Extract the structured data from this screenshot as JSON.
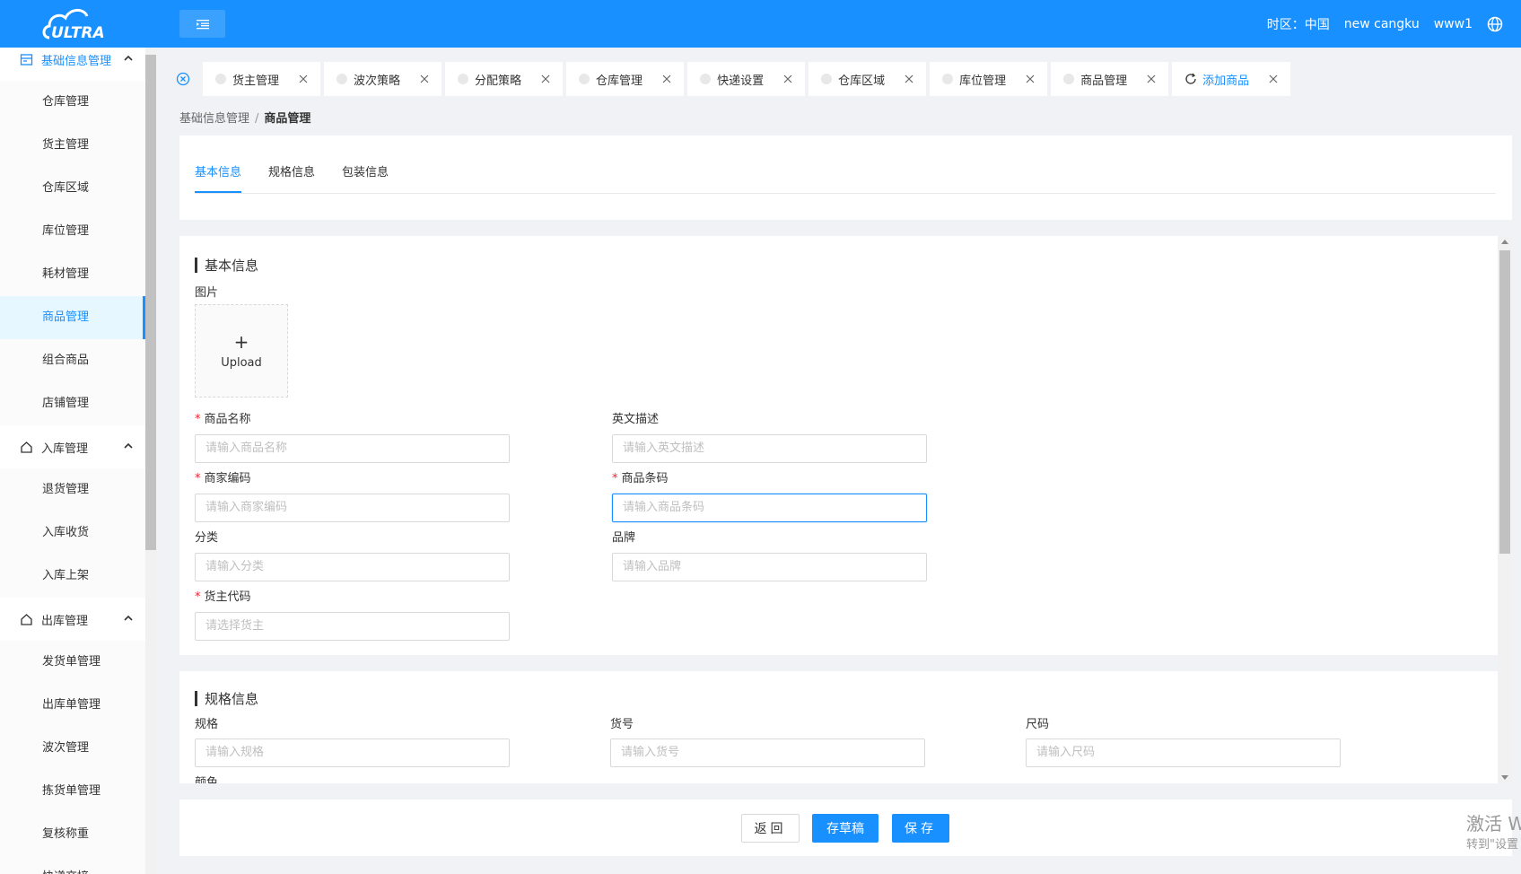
{
  "header": {
    "logo_text": "ULTRA",
    "timezone": "时区：中国",
    "warehouse": "new cangku",
    "user": "www1"
  },
  "sidebar": {
    "groups": [
      {
        "label": "基础信息管理",
        "items": [
          "仓库管理",
          "货主管理",
          "仓库区域",
          "库位管理",
          "耗材管理",
          "商品管理",
          "组合商品",
          "店铺管理"
        ]
      },
      {
        "label": "入库管理",
        "items": [
          "退货管理",
          "入库收货",
          "入库上架"
        ]
      },
      {
        "label": "出库管理",
        "items": [
          "发货单管理",
          "出库单管理",
          "波次管理",
          "拣货单管理",
          "复核称重",
          "快递交接"
        ]
      }
    ]
  },
  "tabs": [
    "货主管理",
    "波次策略",
    "分配策略",
    "仓库管理",
    "快递设置",
    "仓库区域",
    "库位管理",
    "商品管理",
    "添加商品"
  ],
  "breadcrumb": {
    "parent": "基础信息管理",
    "current": "商品管理"
  },
  "section_tabs": [
    "基本信息",
    "规格信息",
    "包装信息"
  ],
  "basic_info": {
    "title": "基本信息",
    "image_label": "图片",
    "upload_label": "Upload",
    "fields": {
      "name_label": "商品名称",
      "name_placeholder": "请输入商品名称",
      "en_desc_label": "英文描述",
      "en_desc_placeholder": "请输入英文描述",
      "merchant_code_label": "商家编码",
      "merchant_code_placeholder": "请输入商家编码",
      "barcode_label": "商品条码",
      "barcode_placeholder": "请输入商品条码",
      "category_label": "分类",
      "category_placeholder": "请输入分类",
      "brand_label": "品牌",
      "brand_placeholder": "请输入品牌",
      "owner_code_label": "货主代码",
      "owner_code_placeholder": "请选择货主"
    }
  },
  "spec_info": {
    "title": "规格信息",
    "fields": {
      "spec_label": "规格",
      "spec_placeholder": "请输入规格",
      "item_no_label": "货号",
      "item_no_placeholder": "请输入货号",
      "size_label": "尺码",
      "size_placeholder": "请输入尺码",
      "color_label": "颜色"
    }
  },
  "actions": {
    "back": "返回",
    "draft": "存草稿",
    "save": "保存"
  },
  "watermark": {
    "line1": "激活 W",
    "line2": "转到\"设置"
  },
  "colors": {
    "primary": "#1890ff",
    "required": "#f5222d"
  }
}
